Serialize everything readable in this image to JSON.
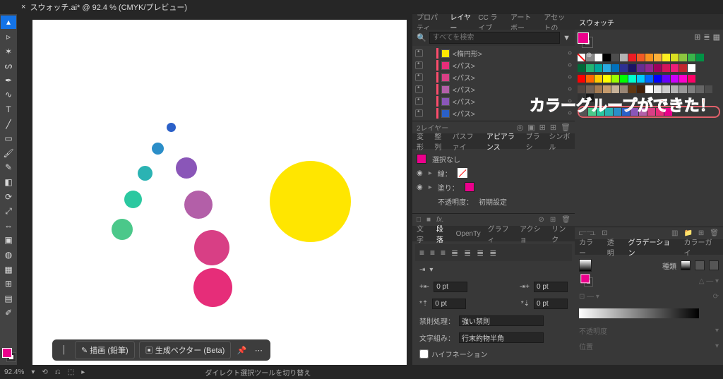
{
  "doc": {
    "tab_title": "スウォッチ.ai* @ 92.4 % (CMYK/プレビュー)"
  },
  "status": {
    "zoom": "92.4%",
    "tool_tip": "ダイレクト選択ツールを切り替え"
  },
  "context_bar": {
    "draw_label": "描画 (鉛筆)",
    "gen_vector_label": "生成ベクター (Beta)"
  },
  "fill_color": "#ec008c",
  "layers_panel": {
    "tabs": [
      "プロパティ",
      "レイヤー",
      "CC ライブ",
      "アートボー",
      "アセットの"
    ],
    "active_tab": 1,
    "search_placeholder": "すべてを検索",
    "rows": [
      {
        "name": "<楕円形>",
        "thumb": "#ffe600"
      },
      {
        "name": "<パス>",
        "thumb": "#e62d79"
      },
      {
        "name": "<パス>",
        "thumb": "#d83f85"
      },
      {
        "name": "<パス>",
        "thumb": "#b35fa8"
      },
      {
        "name": "<パス>",
        "thumb": "#8a56b8"
      },
      {
        "name": "<パス>",
        "thumb": "#2b60c8"
      }
    ],
    "footer_label": "2レイヤー"
  },
  "transform_tabs": [
    "変形",
    "整列",
    "パスファイ",
    "アピアランス",
    "ブラシ",
    "シンボル"
  ],
  "appearance": {
    "selection": "選択なし",
    "stroke_label": "線：",
    "fill_label": "塗り：",
    "opacity_label": "不透明度：",
    "opacity_value": "初期設定"
  },
  "type_tabs": [
    "文字",
    "段落",
    "OpenTy",
    "グラフィ",
    "アクショ",
    "リンク"
  ],
  "paragraph": {
    "indent_left": "0 pt",
    "indent_right": "0 pt",
    "space_before": "0 pt",
    "space_after": "0 pt",
    "kinsoku_label": "禁則処理：",
    "kinsoku_value": "強い禁則",
    "mojikumi_label": "文字組み：",
    "mojikumi_value": "行末約物半角",
    "hyphenation_label": "ハイフネーション"
  },
  "swatches_panel": {
    "title": "スウォッチ",
    "palette_row1": [
      "#ffffff",
      "#000000",
      "#4d4d4d",
      "#b3b3b3",
      "#ed1c24",
      "#f15a24",
      "#f7931e",
      "#fbb03b",
      "#fcee21",
      "#d9e021",
      "#8cc63f",
      "#39b54a",
      "#009245"
    ],
    "palette_row2": [
      "#006837",
      "#22b573",
      "#00a99d",
      "#29abe2",
      "#0071bc",
      "#2e3192",
      "#1b1464",
      "#662d91",
      "#93278f",
      "#9e005d",
      "#d4145a",
      "#ed1e79",
      "#c1272d",
      "#ffffff"
    ],
    "palette_row3": [
      "#ff0000",
      "#ff6600",
      "#ffcc00",
      "#ffff00",
      "#99ff00",
      "#00ff00",
      "#00ffcc",
      "#00ccff",
      "#0066ff",
      "#0000ff",
      "#6600ff",
      "#cc00ff",
      "#ff00cc",
      "#ff0066"
    ],
    "palette_row4": [
      "#534741",
      "#736357",
      "#a67c52",
      "#c69c6d",
      "#c7b299",
      "#998675",
      "#603813",
      "#42210b",
      "#ffffff",
      "#e6e6e6",
      "#cccccc",
      "#b3b3b3",
      "#999999",
      "#808080",
      "#666666",
      "#4d4d4d",
      "#333333",
      "#1a1a1a"
    ],
    "group_colors": [
      "#4bc88a",
      "#2bc8a0",
      "#2bb3b3",
      "#2b8ec8",
      "#2b60c8",
      "#8a56b8",
      "#b35fa8",
      "#d83f85",
      "#e62d79",
      "#ec008c"
    ]
  },
  "callout_text": "カラーグループができた！",
  "color_tabs": [
    "カラー",
    "透明",
    "グラデーション",
    "カラーガイ"
  ],
  "gradient": {
    "type_label": "種類",
    "opacity_label": "不透明度",
    "position_label": "位置"
  },
  "icons": {
    "close": "×",
    "arrow": "▸",
    "search": "🔍",
    "filter": "⑂",
    "align_l": "≡",
    "align_c": "≡",
    "align_r": "≡",
    "justify": "≣",
    "trash": "🗑",
    "new": "⊞",
    "link": "🔗",
    "folder": "📁"
  }
}
